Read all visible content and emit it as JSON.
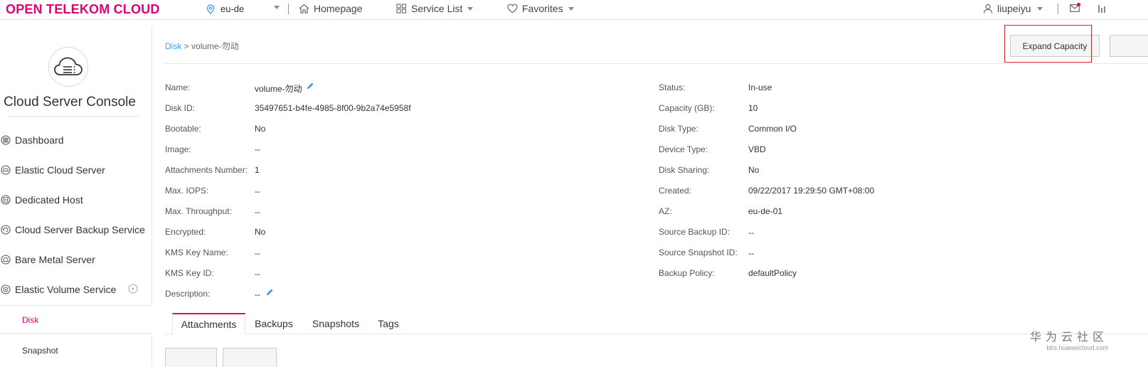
{
  "header": {
    "logo": "OPEN TELEKOM CLOUD",
    "region": "eu-de",
    "nav": {
      "homepage": "Homepage",
      "service_list": "Service List",
      "favorites": "Favorites"
    },
    "user": "liupeiyu"
  },
  "sidebar": {
    "title": "Cloud Server Console",
    "items": [
      {
        "label": "Dashboard",
        "icon": "dashboard-icon"
      },
      {
        "label": "Elastic Cloud Server",
        "icon": "cloud-server-icon"
      },
      {
        "label": "Dedicated Host",
        "icon": "host-icon"
      },
      {
        "label": "Cloud Server Backup Service",
        "icon": "backup-icon"
      },
      {
        "label": "Bare Metal Server",
        "icon": "bare-metal-icon"
      },
      {
        "label": "Elastic Volume Service",
        "icon": "volume-icon"
      }
    ],
    "sub_items": {
      "disk": "Disk",
      "snapshot": "Snapshot"
    }
  },
  "breadcrumb": {
    "root": "Disk",
    "separator": " > ",
    "current": "volume-勿动"
  },
  "actions": {
    "expand_capacity": "Expand Capacity"
  },
  "details_left": [
    {
      "label": "Name:",
      "value": "volume-勿动"
    },
    {
      "label": "Disk ID:",
      "value": "35497651-b4fe-4985-8f00-9b2a74e5958f"
    },
    {
      "label": "Bootable:",
      "value": "No"
    },
    {
      "label": "Image:",
      "value": "--"
    },
    {
      "label": "Attachments Number:",
      "value": "1"
    },
    {
      "label": "Max. IOPS:",
      "value": "--"
    },
    {
      "label": "Max. Throughput:",
      "value": "--"
    },
    {
      "label": "Encrypted:",
      "value": "No"
    },
    {
      "label": "KMS Key Name:",
      "value": "--"
    },
    {
      "label": "KMS Key ID:",
      "value": "--"
    },
    {
      "label": "Description:",
      "value": "--"
    }
  ],
  "details_right": [
    {
      "label": "Status:",
      "value": "In-use"
    },
    {
      "label": "Capacity (GB):",
      "value": "10"
    },
    {
      "label": "Disk Type:",
      "value": "Common I/O"
    },
    {
      "label": "Device Type:",
      "value": "VBD"
    },
    {
      "label": "Disk Sharing:",
      "value": "No"
    },
    {
      "label": "Created:",
      "value": "09/22/2017 19:29:50 GMT+08:00"
    },
    {
      "label": "AZ:",
      "value": "eu-de-01"
    },
    {
      "label": "Source Backup ID:",
      "value": "--"
    },
    {
      "label": "Source Snapshot ID:",
      "value": "--"
    },
    {
      "label": "Backup Policy:",
      "value": "defaultPolicy"
    }
  ],
  "tabs": [
    "Attachments",
    "Backups",
    "Snapshots",
    "Tags"
  ],
  "watermark": {
    "line1": "华为云社区",
    "line2": "bbs.huaweicloud.com"
  },
  "colors": {
    "brand": "#e20074",
    "link": "#3ca0e6",
    "highlight": "#d9232d"
  }
}
